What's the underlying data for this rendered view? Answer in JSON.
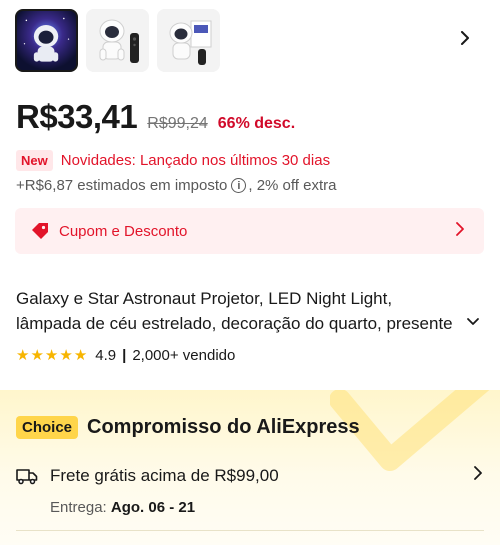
{
  "gallery": {
    "thumbnails": [
      {
        "label": "astronaut-projector-galaxy"
      },
      {
        "label": "astronaut-projector-with-remote"
      },
      {
        "label": "astronaut-projector-with-box"
      }
    ]
  },
  "pricing": {
    "price": "R$33,41",
    "original_price": "R$99,24",
    "discount": "66% desc."
  },
  "promo": {
    "new_badge": "New",
    "new_text": "Novidades: Lançado nos últimos 30 dias"
  },
  "tax": {
    "text": "+R$6,87 estimados em imposto",
    "info_glyph": "i",
    "extra": ", 2% off extra"
  },
  "coupon": {
    "label": "Cupom e Desconto"
  },
  "product": {
    "title_line1": "Galaxy e Star Astronaut Projetor, LED Night Light,",
    "title_line2": "lâmpada de céu estrelado, decoração do quarto, presente"
  },
  "rating": {
    "score": "4.9",
    "separator": "|",
    "sold": "2,000+ vendido",
    "stars": 5
  },
  "choice": {
    "badge": "Choice",
    "title": "Compromisso do AliExpress",
    "shipping": "Frete grátis acima de R$99,00",
    "delivery_label": "Entrega:",
    "delivery_dates": "Ago. 06 - 21"
  },
  "colors": {
    "accent_red": "#e2142a",
    "choice_yellow": "#ffd54a",
    "star_gold": "#f7b500"
  },
  "icons": [
    "chevron-right-icon",
    "info-icon",
    "coupon-tag-icon",
    "chevron-down-icon",
    "star-icon",
    "truck-icon"
  ]
}
